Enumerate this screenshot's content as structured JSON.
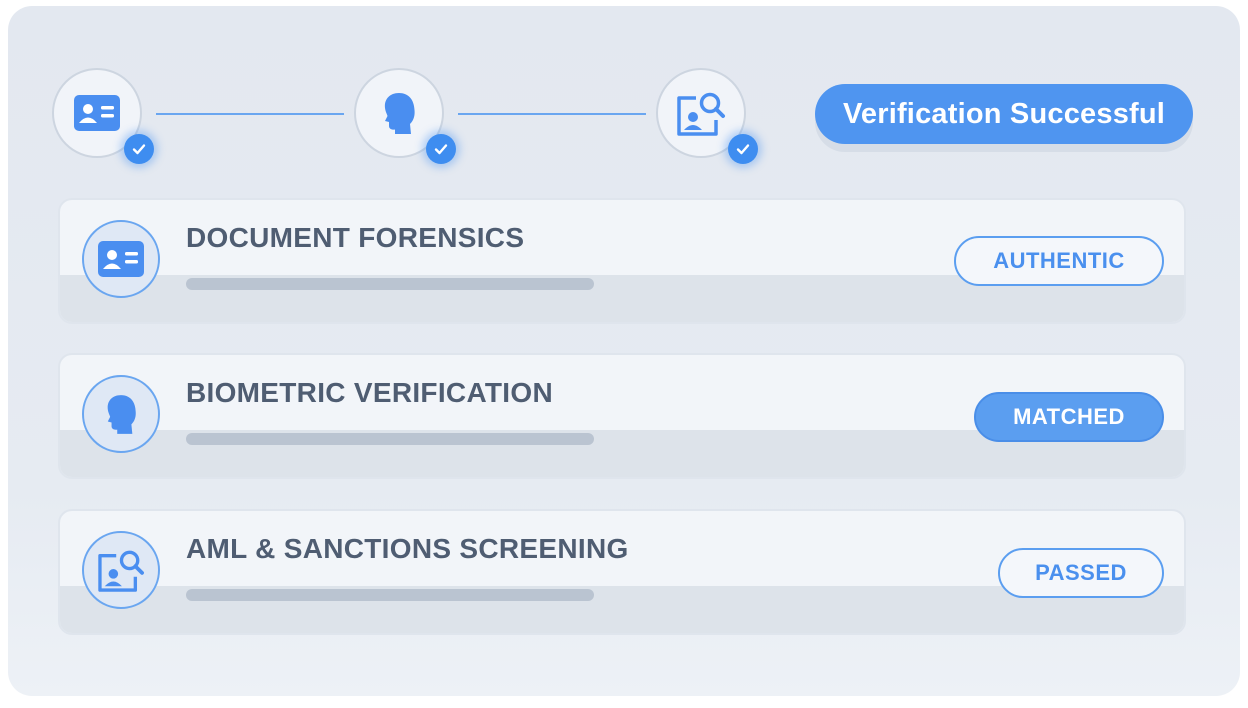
{
  "colors": {
    "accent": "#4f95f0",
    "panel_bg": "#e3e8f0",
    "card_bg": "#f2f5f9",
    "title_text": "#4f5d72",
    "progress_track": "#bac4d1"
  },
  "steps": [
    {
      "icon": "id-card-icon",
      "completed": true
    },
    {
      "icon": "face-profile-icon",
      "completed": true
    },
    {
      "icon": "document-search-icon",
      "completed": true
    }
  ],
  "status": {
    "label": "Verification Successful"
  },
  "checks": [
    {
      "title": "DOCUMENT FORENSICS",
      "badge": "AUTHENTIC",
      "badge_style": "outline",
      "icon": "id-card-icon"
    },
    {
      "title": "BIOMETRIC VERIFICATION",
      "badge": "MATCHED",
      "badge_style": "filled",
      "icon": "face-profile-icon"
    },
    {
      "title": "AML & SANCTIONS SCREENING",
      "badge": "PASSED",
      "badge_style": "outline",
      "icon": "document-search-icon"
    }
  ]
}
